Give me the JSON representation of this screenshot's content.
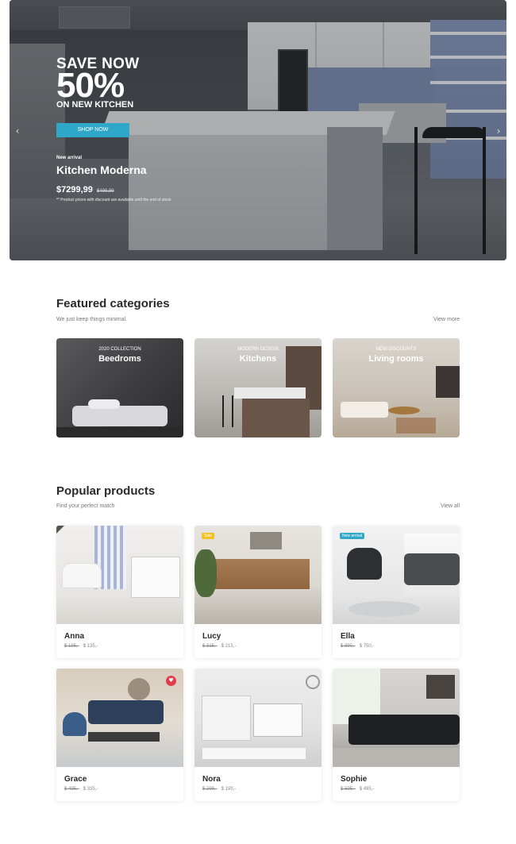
{
  "hero": {
    "headline_top": "SAVE NOW",
    "headline_percent": "50%",
    "headline_bottom": "ON NEW KITCHEN",
    "cta_label": "SHOP NOW",
    "badge": "New arrival",
    "product_name": "Kitchen Moderna",
    "price": "$7299,99",
    "old_price": "$499,99",
    "note": "** Product prices with discount are available until the end of stock",
    "prev_icon": "chevron-left-icon",
    "next_icon": "chevron-right-icon"
  },
  "featured": {
    "title": "Featured categories",
    "subtitle": "We just keep things minimal.",
    "link": "View more",
    "categories": [
      {
        "eyebrow": "2020 COLLECTION",
        "name": "Beedroms"
      },
      {
        "eyebrow": "MODERN DESIGN",
        "name": "Kitchens"
      },
      {
        "eyebrow": "NEW DISCOUNTS",
        "name": "Living rooms"
      }
    ]
  },
  "popular": {
    "title": "Popular products",
    "subtitle": "Find your perfect match",
    "link": "View all",
    "products": [
      {
        "name": "Anna",
        "old_price": "$ 195,-",
        "price": "$ 135,-"
      },
      {
        "name": "Lucy",
        "old_price": "$ 315,-",
        "price": "$ 215,-",
        "badge": "Sale"
      },
      {
        "name": "Ella",
        "old_price": "$ 890,-",
        "price": "$ 750,-",
        "badge": "New arrival"
      },
      {
        "name": "Grace",
        "old_price": "$ 495,-",
        "price": "$ 335,-",
        "favorite_icon": "heart-icon"
      },
      {
        "name": "Nora",
        "old_price": "$ 299,-",
        "price": "$ 195,-"
      },
      {
        "name": "Sophie",
        "old_price": "$ 595,-",
        "price": "$ 495,-"
      }
    ]
  },
  "colors": {
    "accent": "#2fa7c8",
    "sale": "#f3c024",
    "favorite": "#e23d4d"
  }
}
